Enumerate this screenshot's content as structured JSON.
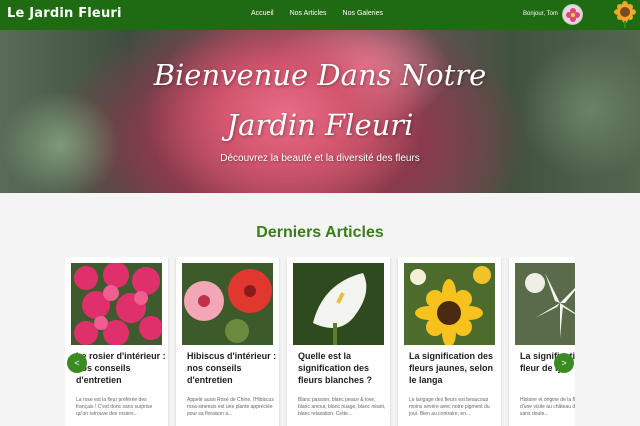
{
  "nav": {
    "brand": "Le Jardin Fleuri",
    "links": [
      "Accueil",
      "Nos Articles",
      "Nos Galeries"
    ],
    "greeting": "Bonjour, Tom"
  },
  "hero": {
    "title_line1": "Bienvenue Dans Notre",
    "title_line2": "Jardin Fleuri",
    "subtitle": "Découvrez la beauté et la diversité des fleurs"
  },
  "section": {
    "title": "Derniers Articles"
  },
  "articles": [
    {
      "title": "Le rosier d'intérieur : nos conseils d'entretien",
      "excerpt": "La rose est la fleur préférée des français ! C'est donc sans surprise qu'on retrouve des rosiers..."
    },
    {
      "title": "Hibiscus d'intérieur : nos conseils d'entretien",
      "excerpt": "Appelé aussi Rosé de Chine, l'Hibiscus rosa-sinensis est une plante appréciée pour sa floraison a..."
    },
    {
      "title": "Quelle est la signification des fleurs blanches ?",
      "excerpt": "Blanc passion, blanc peace & love, blanc amour, blanc nuage, blanc néant, blanc relaxation. Cette..."
    },
    {
      "title": "La signification des fleurs jaunes, selon le langa",
      "excerpt": "Le langage des fleurs est beaucoup moins sévère avec notre pigment du jour. Bien au contraire, en..."
    },
    {
      "title": "La signification de la fleur de lys",
      "excerpt": "Histoire et origine de la fleur de lys Lors d'une visite au château de Versailles, sans doute..."
    }
  ],
  "carousel": {
    "prev": "<",
    "next": ">"
  },
  "colors": {
    "nav": "#1f6b12",
    "accent": "#3a7d1a",
    "arrow": "#3c8a22"
  }
}
